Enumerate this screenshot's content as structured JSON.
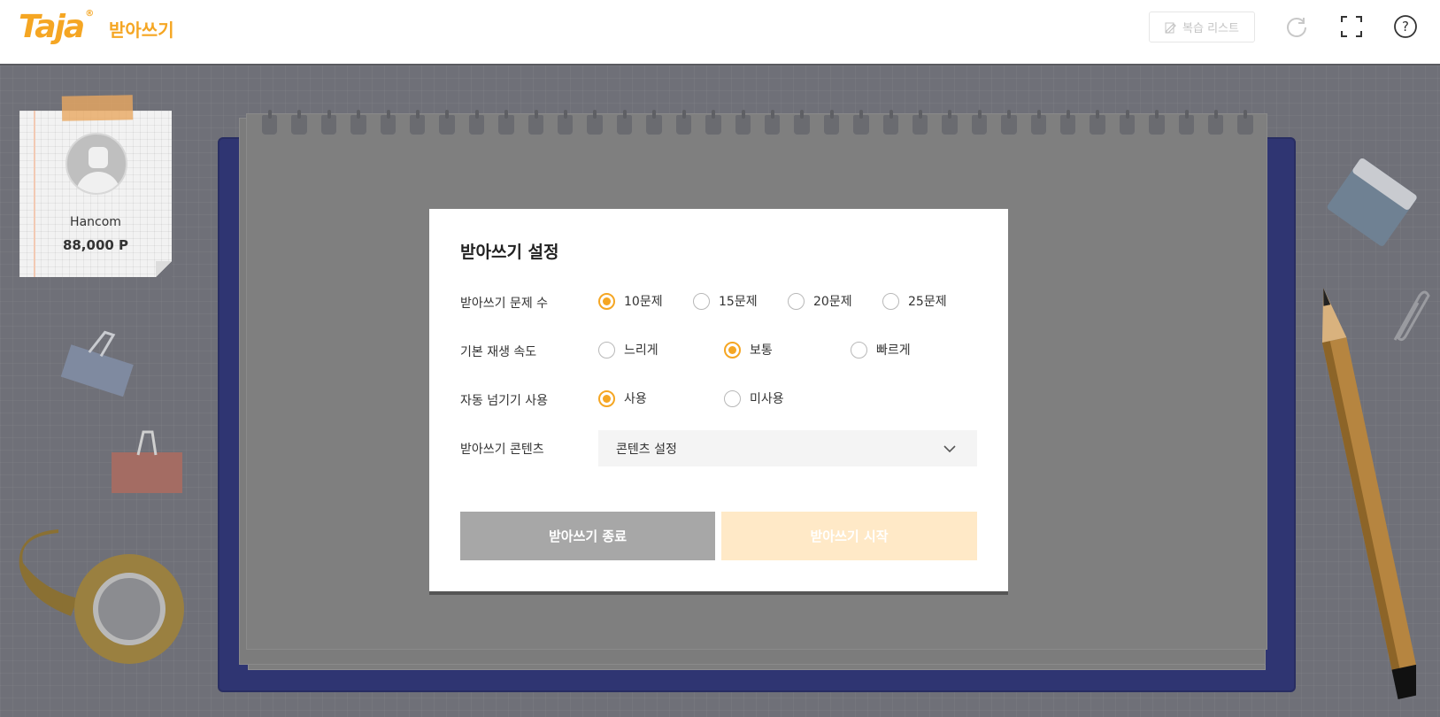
{
  "header": {
    "logo": "Taja",
    "logo_mark": "®",
    "app_title": "받아쓰기",
    "review_list_label": "복습 리스트",
    "icons": [
      "edit-icon",
      "refresh-icon",
      "fullscreen-icon",
      "help-icon"
    ],
    "help_glyph": "?"
  },
  "profile": {
    "name": "Hancom",
    "points": "88,000 P"
  },
  "modal": {
    "title": "받아쓰기 설정",
    "rows": [
      {
        "label": "받아쓰기 문제 수",
        "options": [
          "10문제",
          "15문제",
          "20문제",
          "25문제"
        ],
        "selected": "10문제"
      },
      {
        "label": "기본 재생 속도",
        "options": [
          "느리게",
          "보통",
          "빠르게"
        ],
        "selected": "보통"
      },
      {
        "label": "자동 넘기기 사용",
        "options": [
          "사용",
          "미사용"
        ],
        "selected": "사용"
      },
      {
        "label": "받아쓰기 콘텐츠",
        "select_value": "콘텐츠 설정"
      }
    ],
    "end_button": "받아쓰기 종료",
    "start_button": "받아쓰기 시작"
  },
  "colors": {
    "accent": "#f5a623",
    "start_button_disabled": "#ffe9c7",
    "end_button": "#a7a7a7",
    "notebook_blue": "#2f3572"
  }
}
